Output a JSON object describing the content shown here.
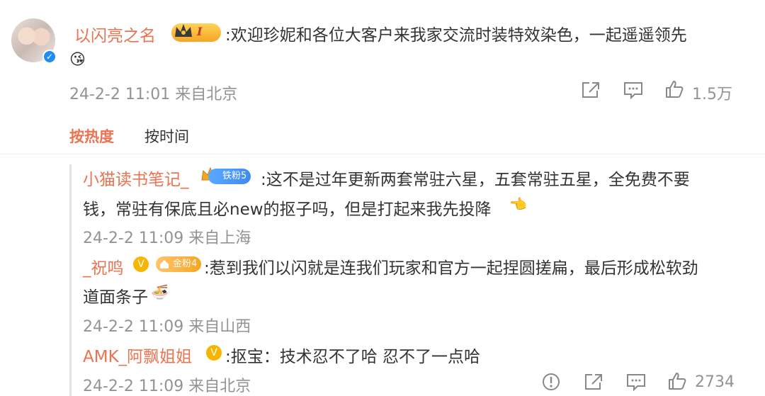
{
  "main_comment": {
    "username": "以闪亮之名",
    "badge_level": "I",
    "text": ":欢迎珍妮和各位大客户来我家交流时装特效染色，一起遥遥领先",
    "emoji": "😘",
    "meta": "24-2-2 11:01 来自北京",
    "likes": "1.5万"
  },
  "sort_tabs": {
    "hot": "按热度",
    "time": "按时间"
  },
  "replies": [
    {
      "username": "小猫读书笔记_",
      "fan_badge": "铁粉5",
      "text_line1": ":这不是过年更新两套常驻六星，五套常驻五星，全免费不要",
      "text_line2": "钱，常驻有保底且必new的抠子吗，但是打起来我先投降",
      "emoji": "👈",
      "meta": "24-2-2 11:09 来自上海"
    },
    {
      "username": "_祝鸣",
      "verified_mark": "V",
      "fan_badge": "金粉4",
      "text_line1": ":惹到我们以闪就是连我们玩家和官方一起捏圆搓扁，最后形成松软劲",
      "text_line2": "道面条子",
      "emoji": "🍜",
      "meta": "24-2-2 11:09 来自山西"
    },
    {
      "username": "AMK_阿飘姐姐",
      "verified_mark": "V",
      "text_line1": ":抠宝：技术忍不了哈 忍不了一点哈",
      "meta": "24-2-2 11:09 来自北京",
      "likes": "2734"
    }
  ],
  "colors": {
    "accent": "#eb7350",
    "meta": "#939393",
    "verified_blue": "#1e8ef0"
  }
}
